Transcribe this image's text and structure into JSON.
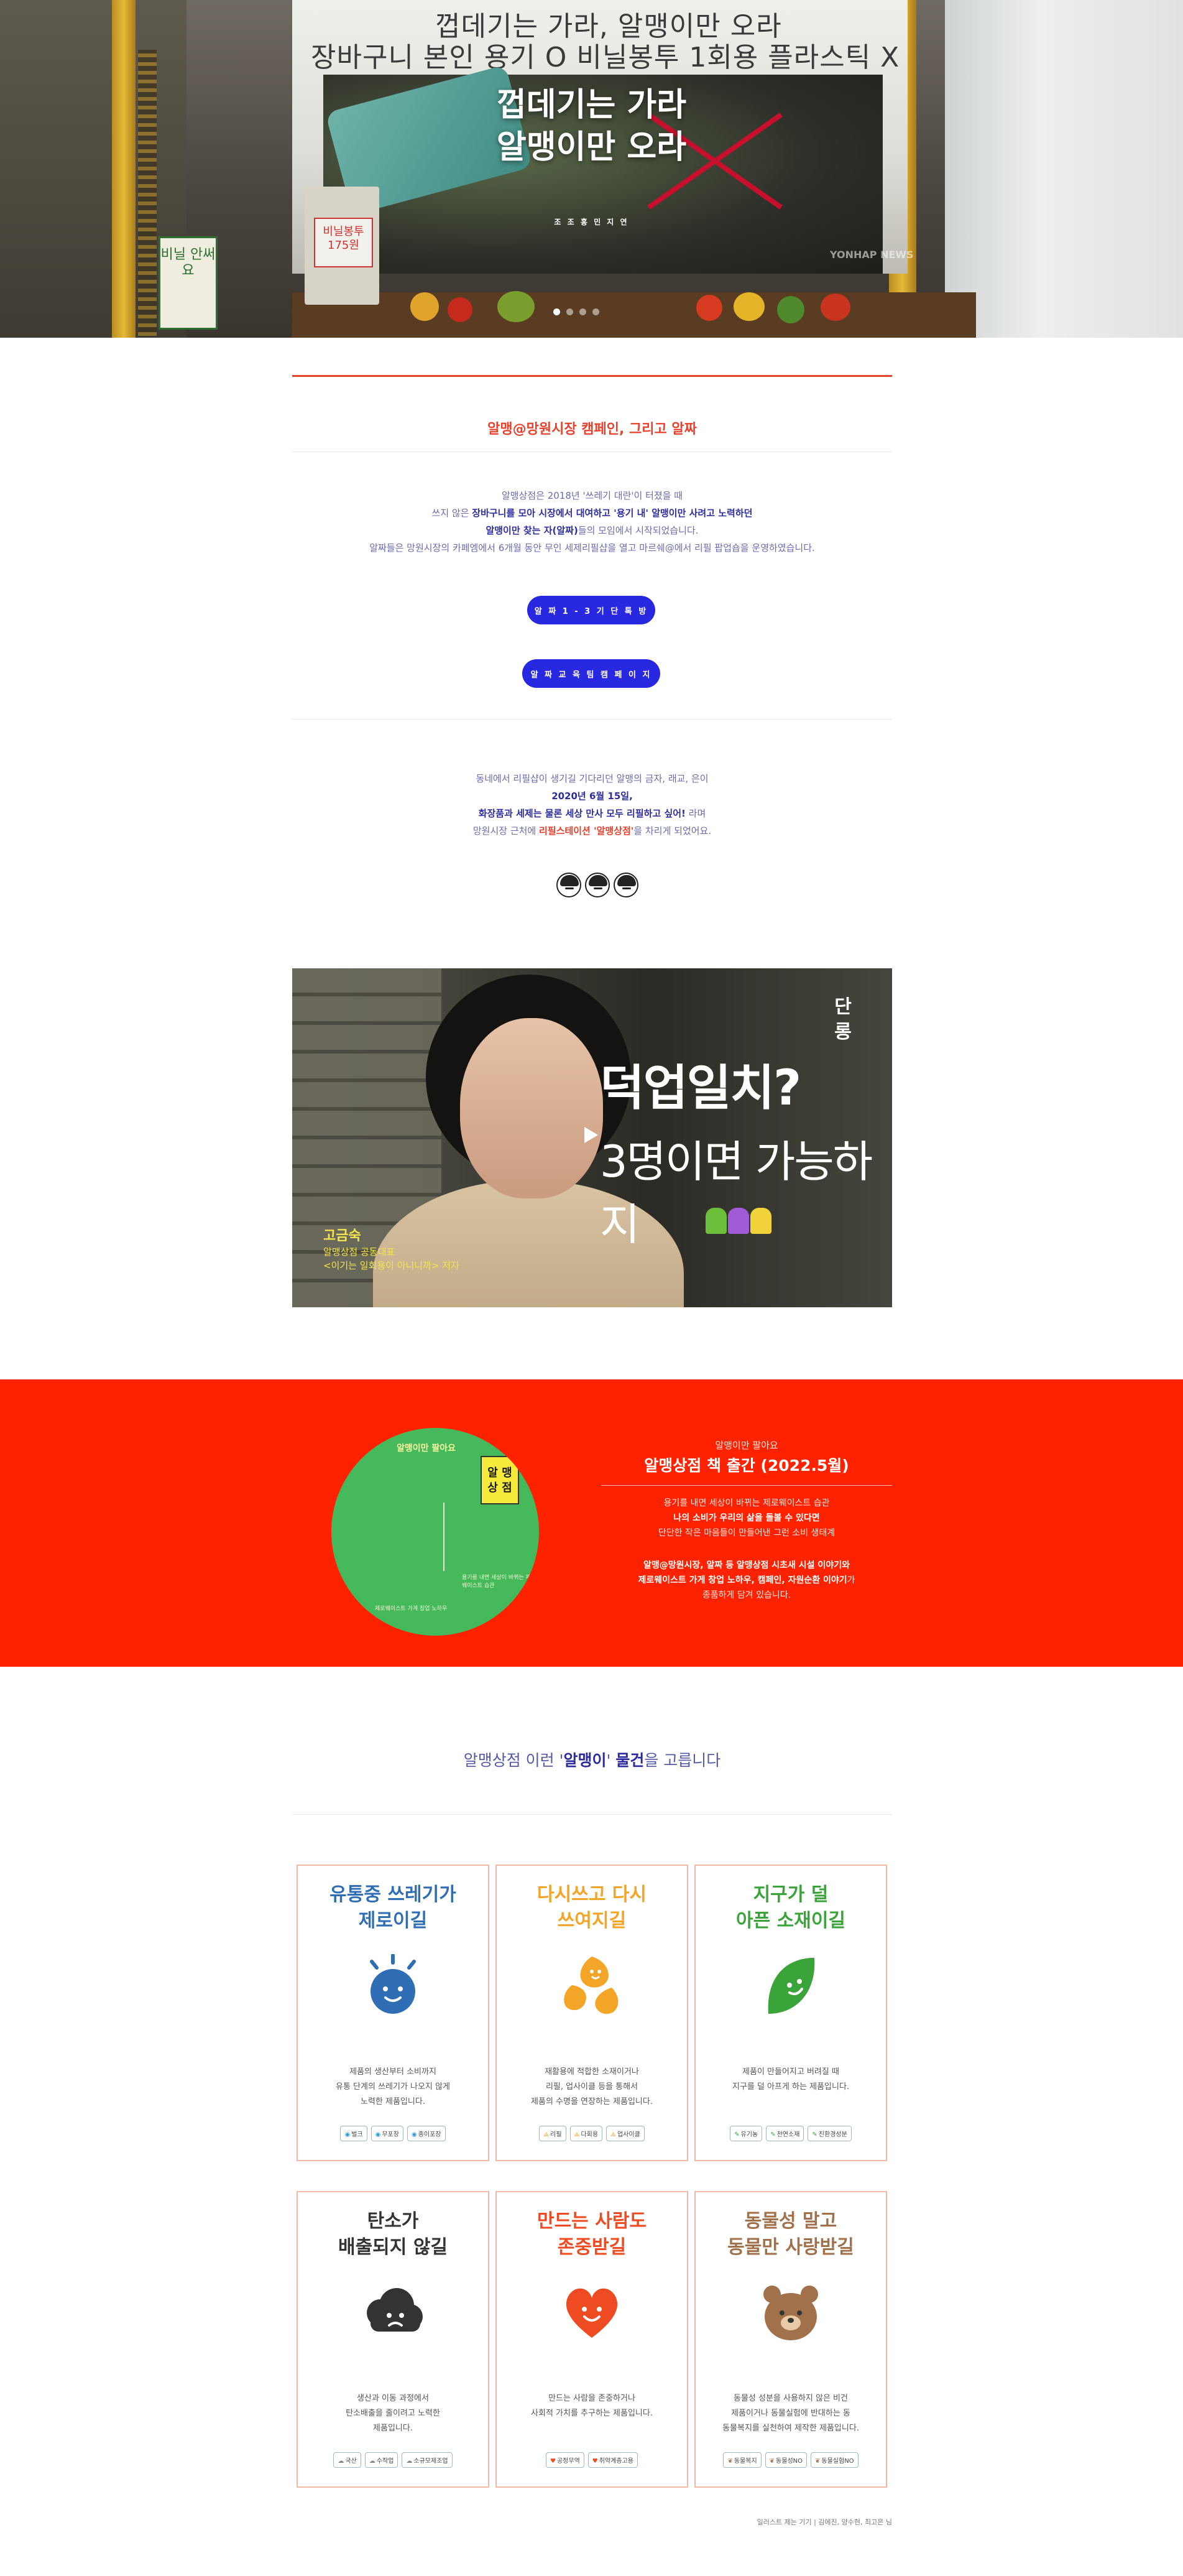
{
  "hero": {
    "board_line1": "껍데기는 가라, 알맹이만 오라",
    "board_line2": "장바구니 본인 용기 O   비닐봉투 1회용 플라스틱 X",
    "title_line1": "껍데기는 가라",
    "title_line2": "알맹이만 오라",
    "subtitle": "조 조 홍 민 지 연",
    "bag_tag": "비닐봉투 175원",
    "green_sign": "비닐 안써 요",
    "watermark": "YONHAP NEWS",
    "slide_count": 4,
    "active_slide": 1
  },
  "intro": {
    "section_title": "알맹@망원시장 캠페인, 그리고 알짜",
    "p1_line1": "알맹상점은 2018년 '쓰레기 대란'이 터졌을 때",
    "p1_line2_pre": "쓰지 않은 ",
    "p1_line2_bold": "장바구니를 모아 시장에서 대여하고 '용기 내' 알맹이만 사려고 노력하던",
    "p1_line3_bold": "알맹이만 찾는 자(알짜)",
    "p1_line3_post": "들의 모임에서 시작되었습니다.",
    "p1_line4": "알짜들은 망원시장의 카페엠에서 6개월 동안 무인 세제리필샵을 열고 마르쉐@에서 리필 팝업숍을 운영하였습니다.",
    "btn1": "알 짜 1 - 3 기 단 톡 방",
    "btn2": "알 짜 교 육 팀 캠 페 이 지",
    "p2_line1": "동네에서 리필샵이 생기길 기다리던 알맹의 금자, 래교, 은이",
    "p2_line2": "2020년 6월 15일,",
    "p2_line3_bold": "화장품과 세제는 물론 세상 만사 모두 리필하고 싶어!",
    "p2_line3_post": " 라며",
    "p2_line4_pre": "망원시장 근처에 ",
    "p2_line4_red": "리필스테이션 '알맹상점'",
    "p2_line4_post": "을 차리게 되었어요."
  },
  "video": {
    "big_line1": "덕업일치?",
    "big_line2": "3명이면 가능하지",
    "side_tag": "단 롱",
    "caption_name": "고금숙",
    "caption_line1": "알맹상점 공동대표",
    "caption_line2": "<이기는 일회용이 아니니까> 저자"
  },
  "book": {
    "cover_top": "알맹이만 팔아요",
    "cover_sign": "알 맹 상 점",
    "cover_note": "용기를 내면 세상이 바뀌는 제로웨이스트 습관",
    "cover_bottom": "제로웨이스트 가게 창업 노하우",
    "small": "알맹이만 팔아요",
    "heading": "알맹상점 책 출간 (2022.5월)",
    "p1_line1": "용기를 내면 세상이 바뀌는 제로웨이스트 습관",
    "p1_line2": "나의 소비가 우리의 삶을 돌볼 수 있다면",
    "p1_line3": "단단한 작은 마음들이 만들어낸 그런 소비 생태계",
    "p2_line1": "알맹@망원시장, 알짜 등 알맹상점 시초새 시설 이야기와",
    "p2_line2": "제로웨이스트 가게 창업 노하우, 캠페인, 자원순환 이야기",
    "p2_line2_post": "가",
    "p2_line3": "종품하게 담겨 있습니다."
  },
  "products": {
    "title_pre": "알맹상점 이런 '",
    "title_bold": "알맹이",
    "title_mid": "' ",
    "title_bold2": "물건",
    "title_post": "을 고릅니다",
    "cards": [
      {
        "title_line1": "유통중 쓰레기가",
        "title_line2": "제로이길",
        "color": "#2f6eb5",
        "icon": "sun-face-icon",
        "desc_line1": "제품의 생산부터 소비까지",
        "desc_line2": "유통 단계의 쓰레기가 나오지 않게",
        "desc_line3": "노력한 제품입니다.",
        "tags": [
          "벌크",
          "무포장",
          "종이포장"
        ],
        "tag_icon": "◉",
        "tag_color": "#2f9bd8"
      },
      {
        "title_line1": "다시쓰고 다시",
        "title_line2": "쓰여지길",
        "color": "#f2a527",
        "icon": "recycle-drops-icon",
        "desc_line1": "재활용에 적합한 소재이거나",
        "desc_line2": "리필, 업사이클 등을 통해서",
        "desc_line3": "제품의 수명을 연장하는 제품입니다.",
        "tags": [
          "리필",
          "다회용",
          "업사이클"
        ],
        "tag_icon": "⟁",
        "tag_color": "#f2a527"
      },
      {
        "title_line1": "지구가 덜",
        "title_line2": "아픈 소재이길",
        "color": "#3aa33a",
        "icon": "leaf-face-icon",
        "desc_line1": "제품이 만들어지고 버려질 때",
        "desc_line2": "지구를 덜 아프게 하는 제품입니다.",
        "desc_line3": "",
        "tags": [
          "유기농",
          "천연소재",
          "친환경성분"
        ],
        "tag_icon": "✎",
        "tag_color": "#3aa33a"
      },
      {
        "title_line1": "탄소가",
        "title_line2": "배출되지 않길",
        "color": "#333333",
        "icon": "cloud-face-icon",
        "desc_line1": "생산과 이동 과정에서",
        "desc_line2": "탄소배출을 줄이려고 노력한",
        "desc_line3": "제품입니다.",
        "tags": [
          "국산",
          "수작업",
          "소규모제조업"
        ],
        "tag_icon": "☁",
        "tag_color": "#888888"
      },
      {
        "title_line1": "만드는 사람도",
        "title_line2": "존중받길",
        "color": "#ef4b22",
        "icon": "heart-face-icon",
        "desc_line1": "만드는 사람을 존중하거나",
        "desc_line2": "사회적 가치를 추구하는 제품입니다.",
        "desc_line3": "",
        "tags": [
          "공정무역",
          "취약계층고용"
        ],
        "tag_icon": "♥",
        "tag_color": "#ef4b22"
      },
      {
        "title_line1": "동물성 말고",
        "title_line2": "동물만 사랑받길",
        "color": "#a0714a",
        "icon": "bear-face-icon",
        "desc_line1": "동물성 성분을 사용하지 않은 비건",
        "desc_line2": "제품이거나 동물실험에 반대하는 동",
        "desc_line3": "동물복지를 실천하여 제작한 제품입니다.",
        "tags": [
          "동물복지",
          "동물성NO",
          "동물실험NO"
        ],
        "tag_icon": "❦",
        "tag_color": "#a0714a"
      }
    ]
  },
  "footnote": "일러스트 제는 기기 | 김에진, 양수현, 최고은 님"
}
